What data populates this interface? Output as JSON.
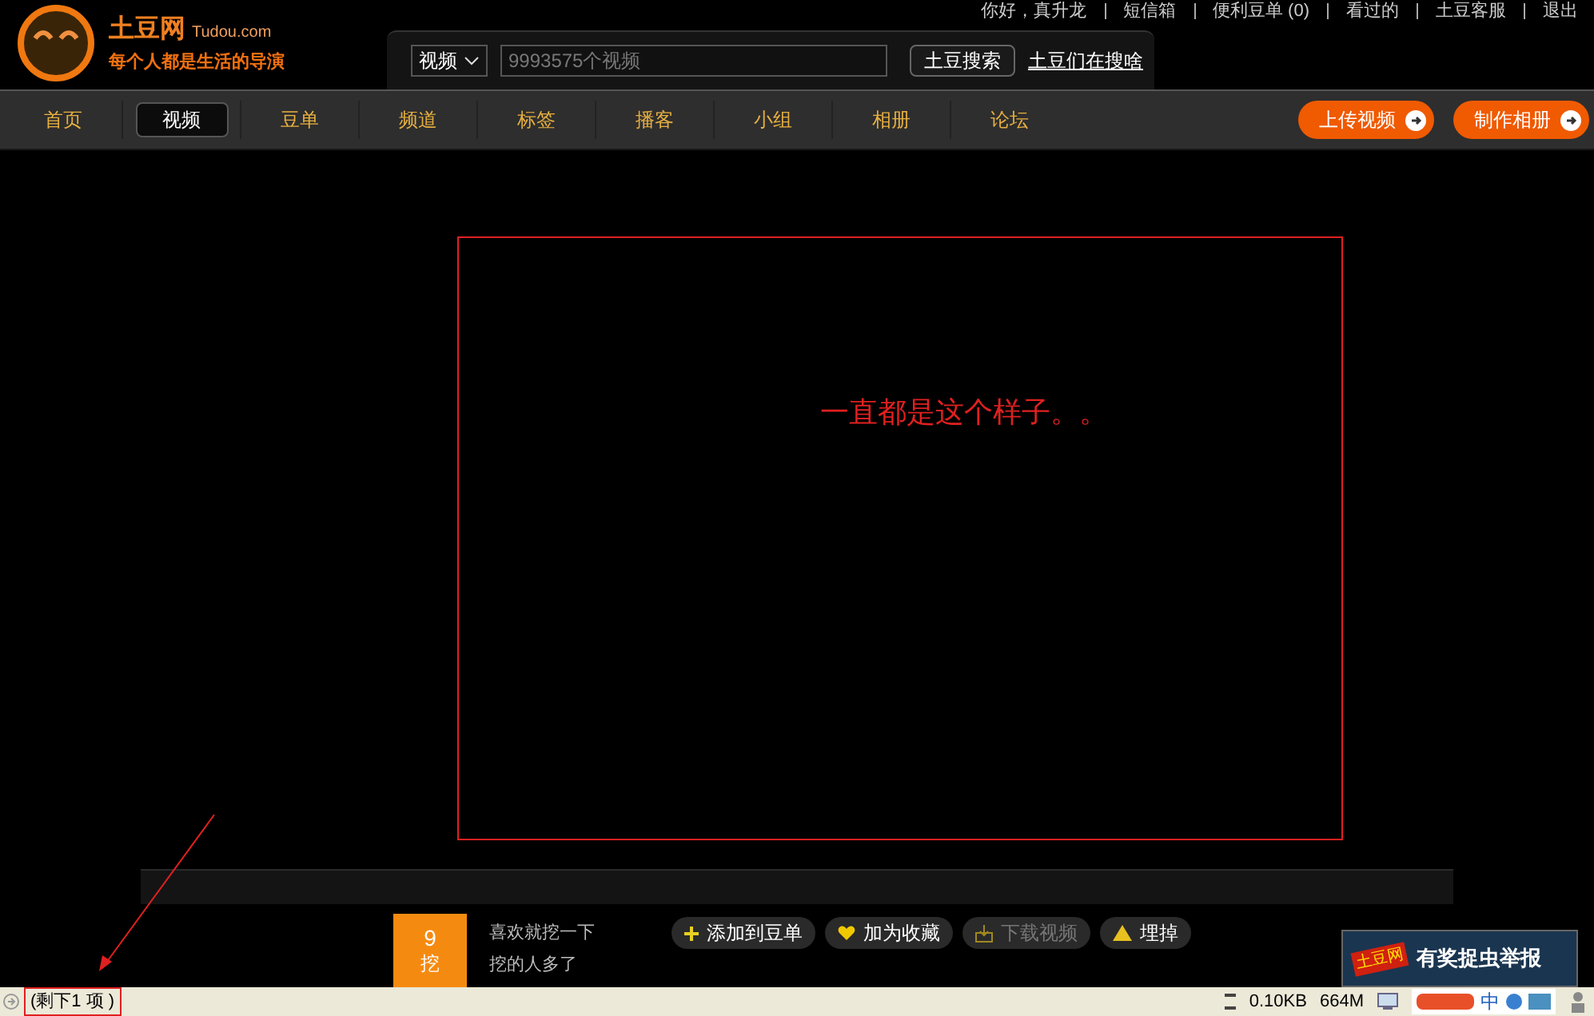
{
  "logo": {
    "name": "土豆网",
    "domain": "Tudou.com",
    "slogan": "每个人都是生活的导演"
  },
  "user_links": [
    "你好，真升龙",
    "短信箱",
    "便利豆单 (0)",
    "看过的",
    "土豆客服",
    "退出"
  ],
  "search": {
    "category": "视频",
    "placeholder": "9993575个视频",
    "button": "土豆搜索",
    "trending_link": "土豆们在搜啥"
  },
  "nav": [
    {
      "label": "首页",
      "selected": false
    },
    {
      "label": "视频",
      "selected": true
    },
    {
      "label": "豆单",
      "selected": false
    },
    {
      "label": "频道",
      "selected": false
    },
    {
      "label": "标签",
      "selected": false
    },
    {
      "label": "播客",
      "selected": false
    },
    {
      "label": "小组",
      "selected": false
    },
    {
      "label": "相册",
      "selected": false
    },
    {
      "label": "论坛",
      "selected": false
    }
  ],
  "nav_actions": [
    "上传视频",
    "制作相册"
  ],
  "annotation": {
    "note": "一直都是这个样子。。"
  },
  "video_actions": {
    "dig": {
      "count": "9",
      "label": "挖"
    },
    "dig_text": [
      "喜欢就挖一下",
      "挖的人多了"
    ],
    "buttons": [
      {
        "label": "添加到豆单",
        "kind": "add",
        "disabled": false
      },
      {
        "label": "加为收藏",
        "kind": "favorite",
        "disabled": false
      },
      {
        "label": "下载视频",
        "kind": "download",
        "disabled": true
      },
      {
        "label": "埋掉",
        "kind": "bury",
        "disabled": false
      }
    ]
  },
  "report_badge": {
    "brand": "土豆网",
    "label": "有奖捉虫举报"
  },
  "status_bar": {
    "message": "(剩下1 项 )",
    "transfer": "0.10KB",
    "memory": "664M",
    "ime": "中"
  }
}
